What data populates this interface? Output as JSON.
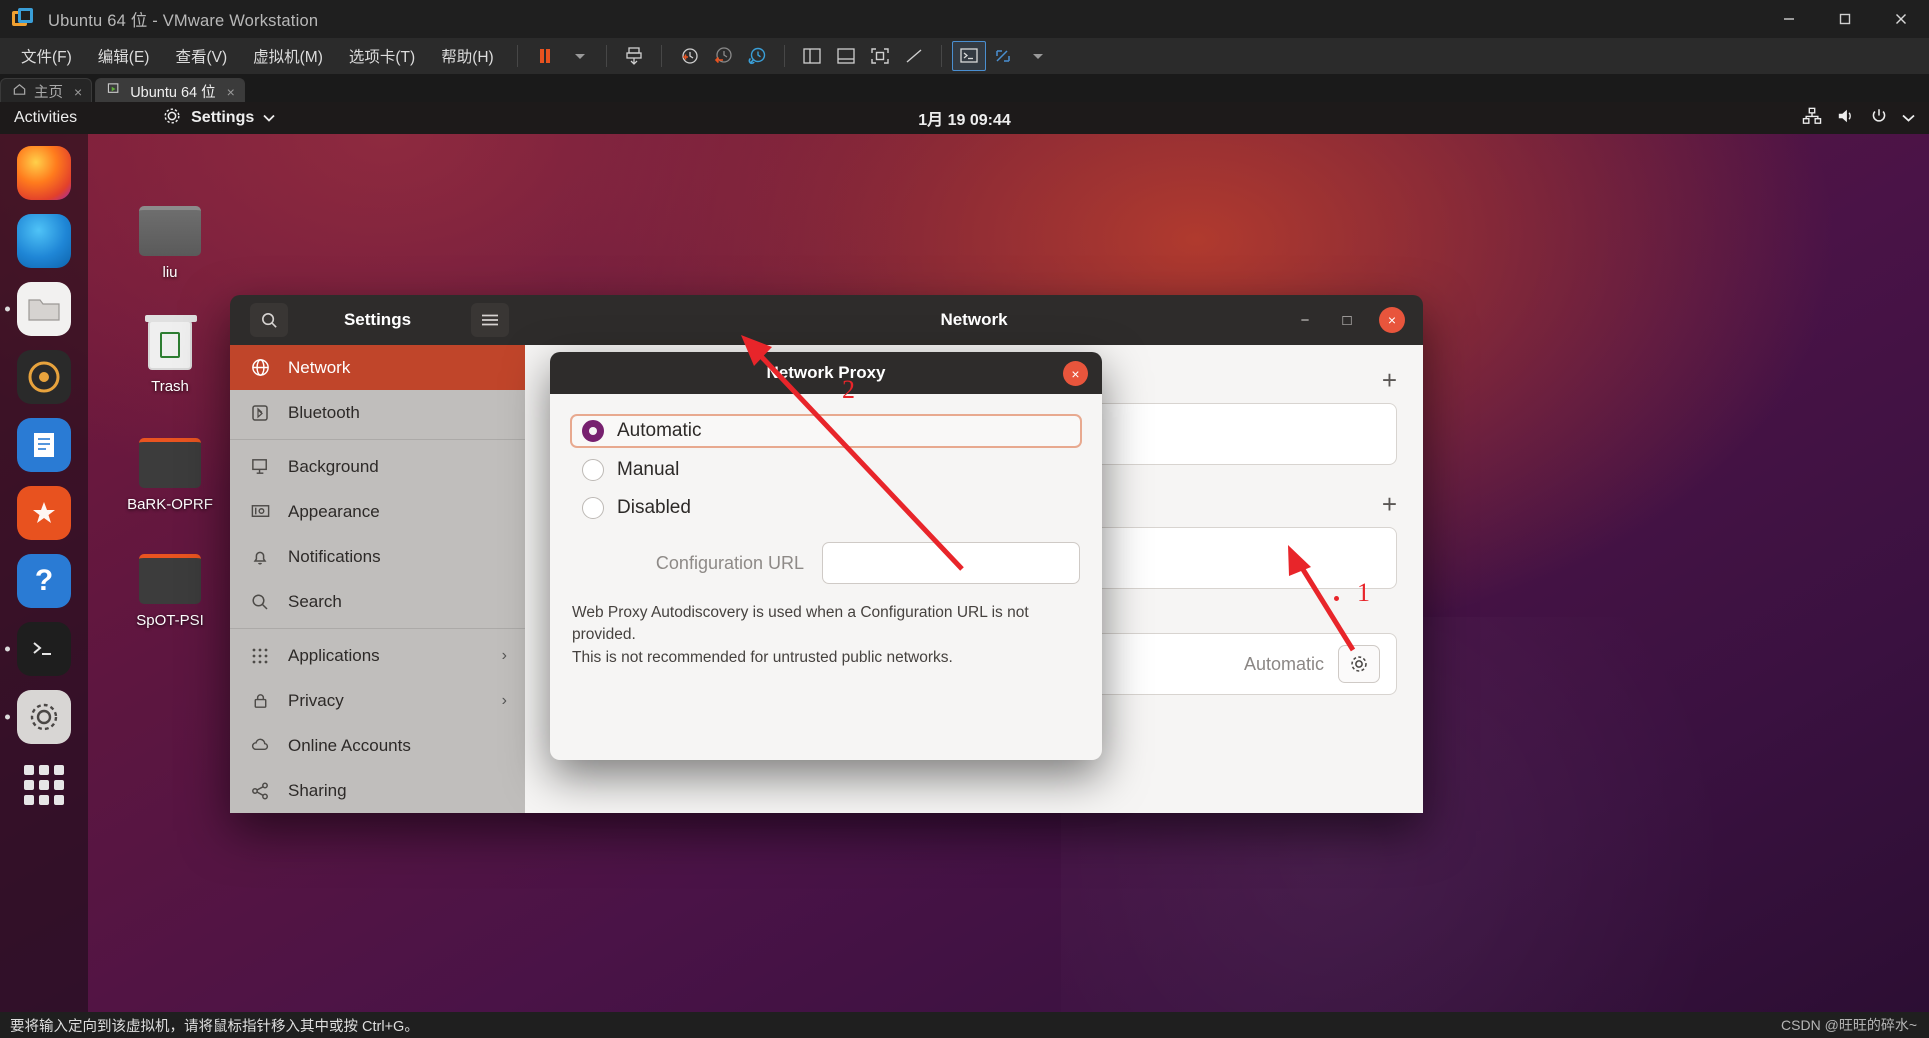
{
  "vmware": {
    "title": "Ubuntu 64 位 - VMware Workstation",
    "logo_icon": "vmware-logo-icon",
    "window_controls": {
      "minimize": "minimize-icon",
      "maximize": "maximize-icon",
      "close": "close-icon"
    },
    "menus": [
      {
        "label": "文件(F)"
      },
      {
        "label": "编辑(E)"
      },
      {
        "label": "查看(V)"
      },
      {
        "label": "虚拟机(M)"
      },
      {
        "label": "选项卡(T)"
      },
      {
        "label": "帮助(H)"
      }
    ],
    "toolbar": [
      {
        "name": "pause-icon"
      },
      {
        "name": "dropdown-caret-icon"
      },
      {
        "name": "send-ctrl-alt-del-icon"
      },
      {
        "name": "snapshot-take-icon"
      },
      {
        "name": "snapshot-revert-icon"
      },
      {
        "name": "snapshot-manager-icon"
      },
      {
        "name": "show-sidebar-icon"
      },
      {
        "name": "show-console-icon"
      },
      {
        "name": "fullscreen-icon"
      },
      {
        "name": "stretch-icon"
      },
      {
        "name": "unity-mode-icon"
      },
      {
        "name": "display-settings-icon"
      }
    ],
    "tabs": [
      {
        "label": "主页",
        "icon": "home-icon",
        "active": false,
        "close": "×"
      },
      {
        "label": "Ubuntu 64 位",
        "icon": "vm-running-icon",
        "active": true,
        "close": "×"
      }
    ],
    "statusbar": {
      "message": "要将输入定向到该虚拟机，请将鼠标指针移入其中或按 Ctrl+G。",
      "watermark": "CSDN @旺旺的碎水~"
    }
  },
  "gnome": {
    "activities": "Activities",
    "app_menu": "Settings",
    "app_menu_icon": "settings-gear-icon",
    "clock": "1月 19  09:44",
    "tray": [
      {
        "name": "network-icon"
      },
      {
        "name": "volume-icon"
      },
      {
        "name": "power-icon"
      },
      {
        "name": "chevron-down-icon"
      }
    ]
  },
  "dock": {
    "items": [
      {
        "name": "firefox-icon",
        "running": false
      },
      {
        "name": "thunderbird-icon",
        "running": false
      },
      {
        "name": "files-icon",
        "running": true
      },
      {
        "name": "rhythmbox-icon",
        "running": false
      },
      {
        "name": "libreoffice-writer-icon",
        "running": false
      },
      {
        "name": "ubuntu-software-icon",
        "running": false
      },
      {
        "name": "help-icon",
        "running": false
      },
      {
        "name": "terminal-icon",
        "running": true
      },
      {
        "name": "settings-icon",
        "running": true
      },
      {
        "name": "show-applications-icon",
        "running": false
      }
    ]
  },
  "desktop_files": [
    {
      "label": "liu",
      "type": "home-folder"
    },
    {
      "label": "Trash",
      "type": "trash"
    },
    {
      "label": "BaRK-OPRF",
      "type": "folder"
    },
    {
      "label": "SpOT-PSI",
      "type": "folder"
    }
  ],
  "settings_window": {
    "search_icon": "search-icon",
    "left_title": "Settings",
    "menu_icon": "hamburger-menu-icon",
    "right_title": "Network",
    "controls": {
      "minimize": "−",
      "maximize": "□",
      "close": "×"
    },
    "sidebar": [
      {
        "label": "Network",
        "icon": "globe-icon",
        "active": true,
        "chevron": ""
      },
      {
        "label": "Bluetooth",
        "icon": "bluetooth-icon",
        "active": false,
        "chevron": ""
      },
      {
        "label": "Background",
        "icon": "monitor-icon",
        "active": false,
        "chevron": ""
      },
      {
        "label": "Appearance",
        "icon": "appearance-icon",
        "active": false,
        "chevron": ""
      },
      {
        "label": "Notifications",
        "icon": "bell-icon",
        "active": false,
        "chevron": ""
      },
      {
        "label": "Search",
        "icon": "search-icon",
        "active": false,
        "chevron": ""
      },
      {
        "label": "Applications",
        "icon": "grid-icon",
        "active": false,
        "chevron": "›"
      },
      {
        "label": "Privacy",
        "icon": "lock-icon",
        "active": false,
        "chevron": "›"
      },
      {
        "label": "Online Accounts",
        "icon": "cloud-icon",
        "active": false,
        "chevron": ""
      },
      {
        "label": "Sharing",
        "icon": "share-icon",
        "active": false,
        "chevron": ""
      }
    ],
    "content": {
      "section1_plus": "+",
      "toggle_on": true,
      "gear_icon": "gear-icon",
      "section2_plus": "+",
      "proxy_value": "Automatic",
      "proxy_gear_icon": "gear-icon"
    }
  },
  "proxy_dialog": {
    "title": "Network Proxy",
    "close_icon": "×",
    "options": [
      {
        "label": "Automatic",
        "selected": true,
        "focused": true
      },
      {
        "label": "Manual",
        "selected": false,
        "focused": false
      },
      {
        "label": "Disabled",
        "selected": false,
        "focused": false
      }
    ],
    "url_label": "Configuration URL",
    "url_value": "",
    "description_line1": "Web Proxy Autodiscovery is used when a Configuration URL is not provided.",
    "description_line2": "This is not recommended for untrusted public networks."
  },
  "annotations": {
    "marker_1": "1",
    "marker_2": "2",
    "color": "#e8252a"
  }
}
